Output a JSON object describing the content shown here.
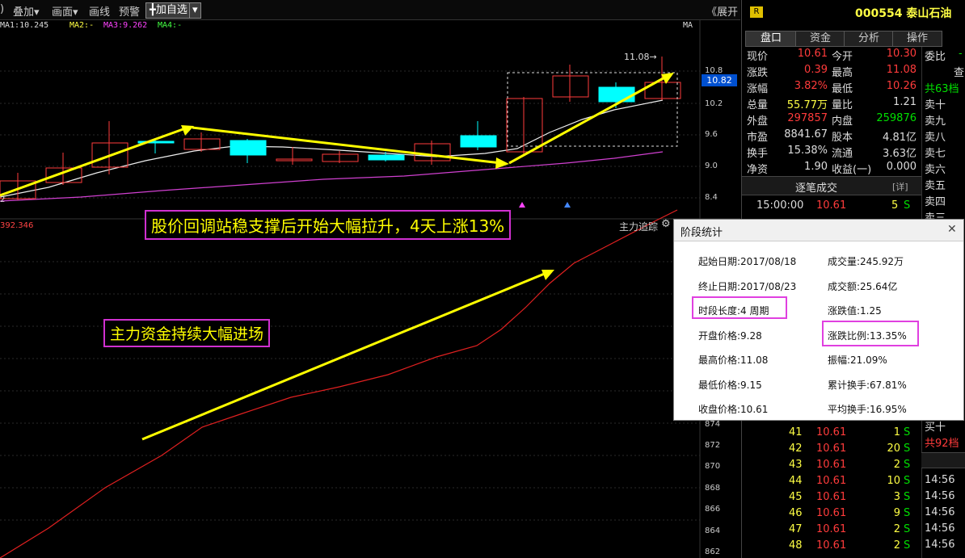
{
  "toolbar": {
    "paren": ")",
    "overlay": "叠加▾",
    "canvas": "画面▾",
    "draw": "画线",
    "alert": "预警",
    "add_fav": "╋加自选",
    "dropdown": "▾",
    "expand": "《展开"
  },
  "ma_row": {
    "ma1": "MA1:10.245",
    "ma2": "MA2:-",
    "ma3": "MA3:9.262",
    "ma4": "MA4:-",
    "ma": "MA"
  },
  "price_axis": [
    "10.8",
    "10.2",
    "9.6",
    "9.0",
    "8.4"
  ],
  "price_current": "10.82",
  "price_max_label": "11.08→",
  "chart_left_label": "2",
  "lower_axis": [
    "874",
    "872",
    "870",
    "868",
    "866",
    "864",
    "862"
  ],
  "lower_left_value": "392.346",
  "lower_indicator": "主力追踪",
  "annotations": {
    "top": "股价回调站稳支撑后开始大幅拉升，4天上涨13%",
    "bottom": "主力资金持续大幅进场"
  },
  "stock": {
    "badge": "R",
    "code_name": "000554 泰山石油"
  },
  "tabs": [
    "盘口",
    "资金",
    "分析",
    "操作"
  ],
  "quote": [
    {
      "l1": "现价",
      "v1": "10.61",
      "c1": "red",
      "l2": "今开",
      "v2": "10.30",
      "c2": "red"
    },
    {
      "l1": "涨跌",
      "v1": "0.39",
      "c1": "red",
      "l2": "最高",
      "v2": "11.08",
      "c2": "red"
    },
    {
      "l1": "涨幅",
      "v1": "3.82%",
      "c1": "red",
      "l2": "最低",
      "v2": "10.26",
      "c2": "red"
    },
    {
      "l1": "总量",
      "v1": "55.77万",
      "c1": "yel",
      "l2": "量比",
      "v2": "1.21",
      "c2": "wht"
    },
    {
      "l1": "外盘",
      "v1": "297857",
      "c1": "red",
      "l2": "内盘",
      "v2": "259876",
      "c2": "grn"
    },
    {
      "l1": "市盈",
      "v1": "8841.67",
      "c1": "wht",
      "l2": "股本",
      "v2": "4.81亿",
      "c2": "wht"
    },
    {
      "l1": "换手",
      "v1": "15.38%",
      "c1": "wht",
      "l2": "流通",
      "v2": "3.63亿",
      "c2": "wht"
    },
    {
      "l1": "净资",
      "v1": "1.90",
      "c1": "wht",
      "l2": "收益(一)",
      "v2": "0.000",
      "c2": "wht"
    }
  ],
  "far_right": {
    "weibi": "委比",
    "weibi_val": "-",
    "cha": "查",
    "total_sell": "共63档",
    "sells": [
      "卖十",
      "卖九",
      "卖八",
      "卖七",
      "卖六",
      "卖五",
      "卖四",
      "卖三"
    ],
    "buy10": "买十",
    "total_buy": "共92档",
    "times": [
      "14:56",
      "14:56",
      "14:56",
      "14:56",
      "14:56"
    ]
  },
  "ticks_header": {
    "title": "逐笔成交",
    "detail": "[详]"
  },
  "tick_first": {
    "time": "15:00:00",
    "price": "10.61",
    "vol": "5",
    "side": "S"
  },
  "ticks": [
    {
      "n": "41",
      "p": "10.61",
      "v": "1",
      "s": "S"
    },
    {
      "n": "42",
      "p": "10.61",
      "v": "20",
      "s": "S"
    },
    {
      "n": "43",
      "p": "10.61",
      "v": "2",
      "s": "S"
    },
    {
      "n": "44",
      "p": "10.61",
      "v": "10",
      "s": "S"
    },
    {
      "n": "45",
      "p": "10.61",
      "v": "3",
      "s": "S"
    },
    {
      "n": "46",
      "p": "10.61",
      "v": "9",
      "s": "S"
    },
    {
      "n": "47",
      "p": "10.61",
      "v": "2",
      "s": "S"
    },
    {
      "n": "48",
      "p": "10.61",
      "v": "2",
      "s": "S"
    }
  ],
  "popup": {
    "title": "阶段统计",
    "close": "✕",
    "left": [
      "起始日期:2017/08/18",
      "终止日期:2017/08/23",
      "时段长度:4 周期",
      "开盘价格:9.28",
      "最高价格:11.08",
      "最低价格:9.15",
      "收盘价格:10.61"
    ],
    "right": [
      "成交量:245.92万",
      "成交额:25.64亿",
      "涨跌值:1.25",
      "涨跌比例:13.35%",
      "振幅:21.09%",
      "累计换手:67.81%",
      "平均换手:16.95%"
    ]
  },
  "colors": {
    "up": "#ff3b3b",
    "down": "#00ffff",
    "annotation": "#ffff00",
    "box": "#e040e0"
  }
}
